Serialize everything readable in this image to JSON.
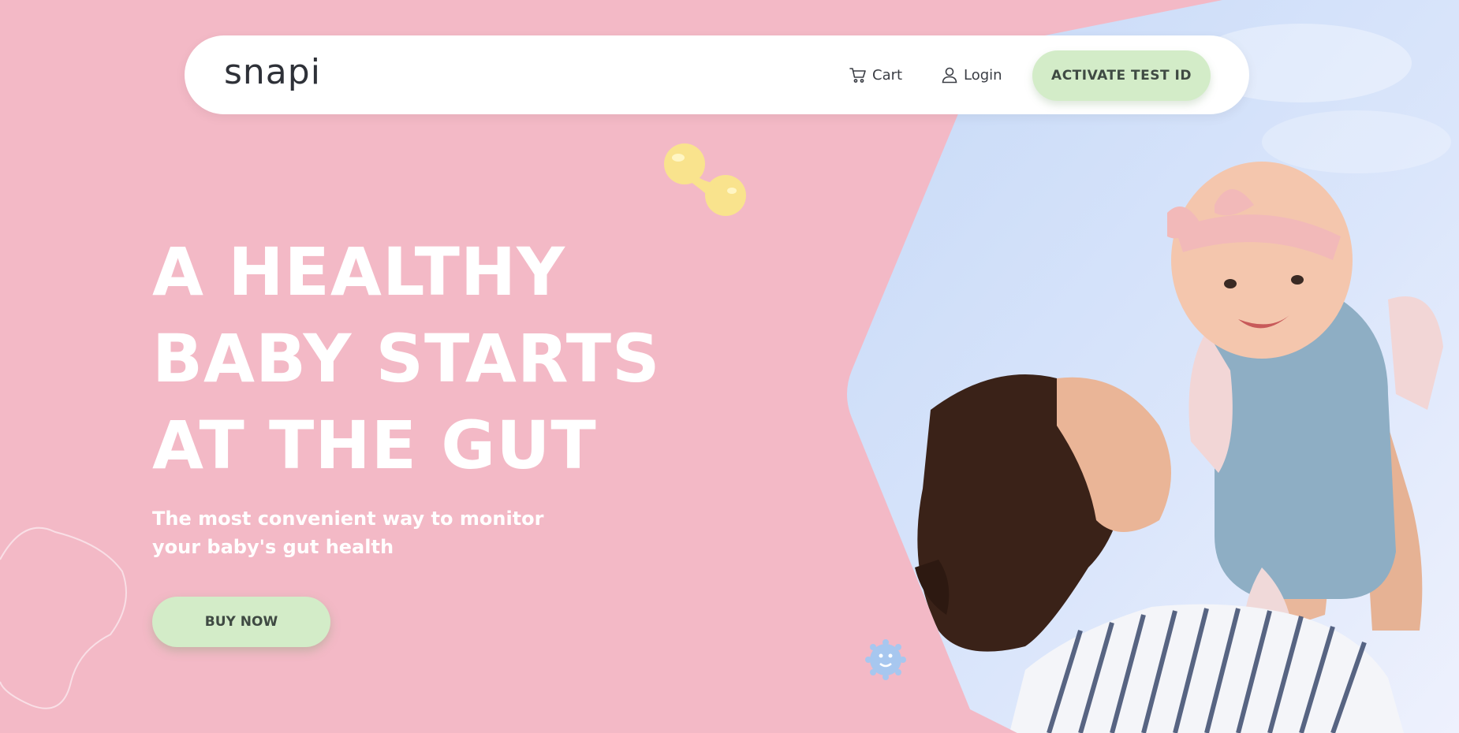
{
  "header": {
    "logo": "snapi",
    "cart_label": "Cart",
    "login_label": "Login",
    "activate_label": "ACTIVATE TEST ID"
  },
  "hero": {
    "headline_lines": [
      "A HEALTHY",
      "BABY STARTS",
      "AT THE GUT"
    ],
    "subtitle_line1": "The most convenient way to monitor",
    "subtitle_line2": "your baby's gut health",
    "buy_label": "BUY NOW"
  },
  "colors": {
    "background": "#f3b9c6",
    "button_green": "#d3ecc8",
    "text_dark": "#3f4a43",
    "sky_blue": "#cfdff8"
  },
  "icons": {
    "cart": "cart-icon",
    "login": "user-icon"
  }
}
